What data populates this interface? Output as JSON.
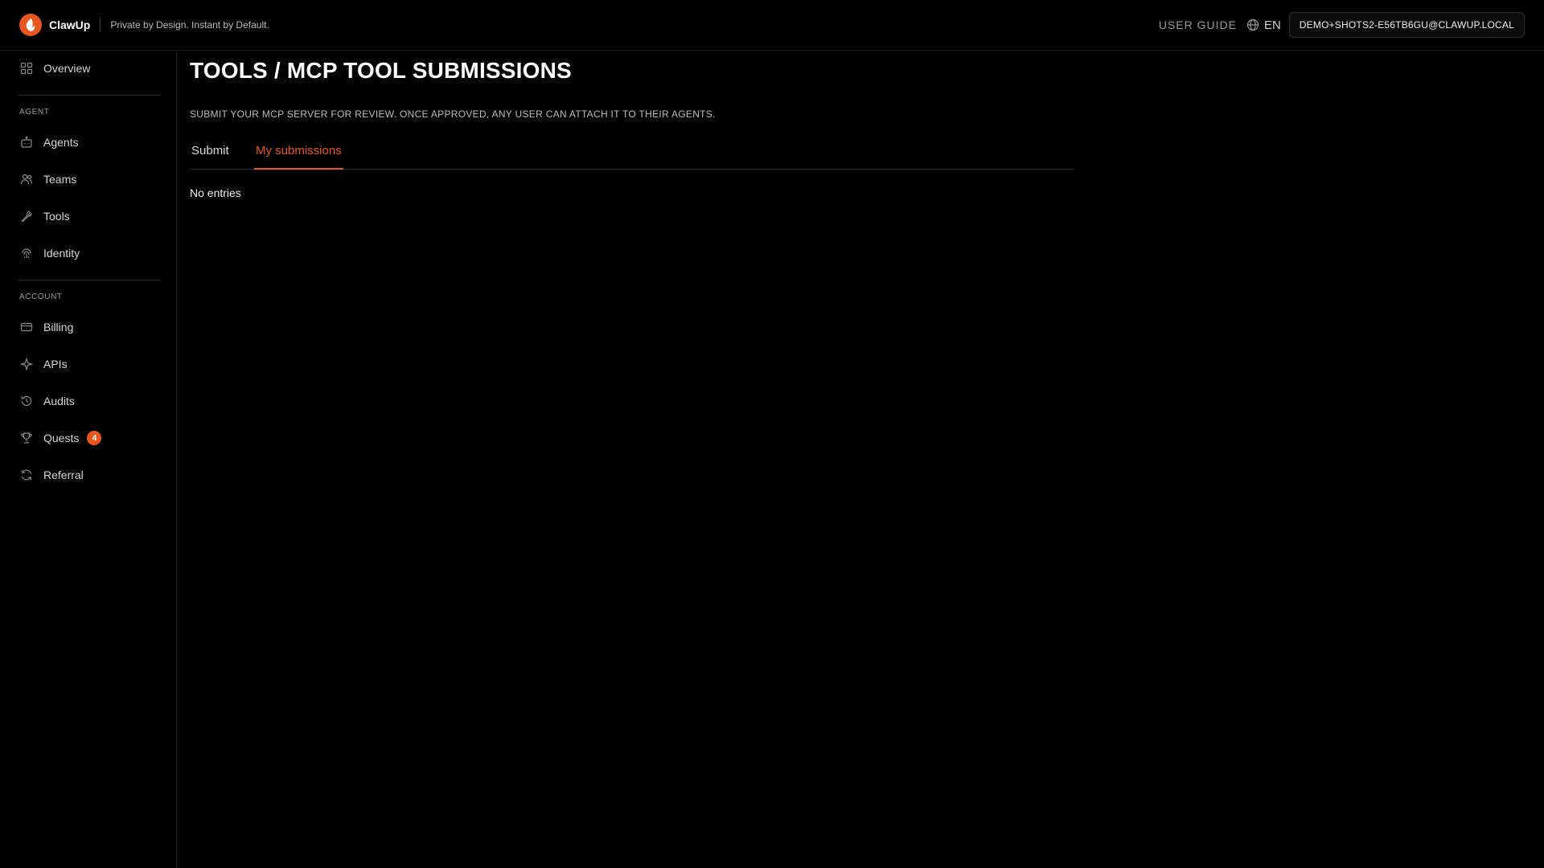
{
  "header": {
    "brand_name": "ClawUp",
    "tagline": "Private by Design. Instant by Default.",
    "user_guide": "USER GUIDE",
    "language": "EN",
    "account_email": "DEMO+SHOTS2-E56TB6GU@CLAWUP.LOCAL"
  },
  "sidebar": {
    "overview": "Overview",
    "agent_section": "AGENT",
    "agent_items": [
      "Agents",
      "Teams",
      "Tools",
      "Identity"
    ],
    "account_section": "ACCOUNT",
    "account_items": [
      "Billing",
      "APIs",
      "Audits",
      "Quests",
      "Referral"
    ],
    "quests_badge": "4"
  },
  "main": {
    "title": "TOOLS / MCP TOOL SUBMISSIONS",
    "description": "SUBMIT YOUR MCP SERVER FOR REVIEW. ONCE APPROVED, ANY USER CAN ATTACH IT TO THEIR AGENTS.",
    "tabs": [
      {
        "label": "Submit",
        "active": false
      },
      {
        "label": "My submissions",
        "active": true
      }
    ],
    "empty_message": "No entries"
  },
  "colors": {
    "accent": "#e8561f",
    "background": "#000000"
  }
}
